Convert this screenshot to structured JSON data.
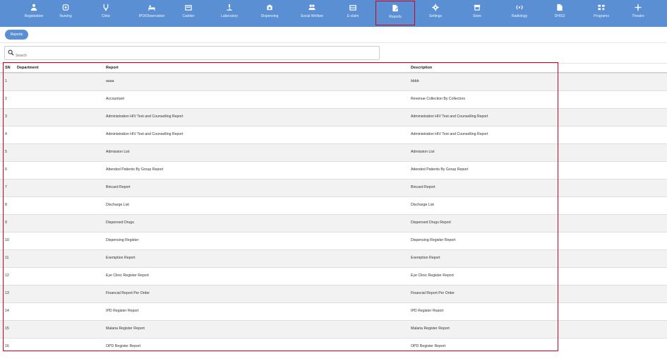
{
  "nav": {
    "items": [
      {
        "label": "Registration",
        "icon": "person-add-icon"
      },
      {
        "label": "Nursing",
        "icon": "nurse-icon"
      },
      {
        "label": "Clinic",
        "icon": "stethoscope-icon"
      },
      {
        "label": "IPD/Observation",
        "icon": "bed-icon"
      },
      {
        "label": "Cashier",
        "icon": "cash-register-icon"
      },
      {
        "label": "Laboratory",
        "icon": "microscope-icon"
      },
      {
        "label": "Dispensing",
        "icon": "medicine-box-icon"
      },
      {
        "label": "Social Welfare",
        "icon": "people-icon"
      },
      {
        "label": "E-claim",
        "icon": "claim-box-icon"
      },
      {
        "label": "Reports",
        "icon": "report-file-icon"
      },
      {
        "label": "Settings",
        "icon": "gear-icon"
      },
      {
        "label": "Store",
        "icon": "store-icon"
      },
      {
        "label": "Radiology",
        "icon": "radiology-icon"
      },
      {
        "label": "DHIS2",
        "icon": "upload-file-icon"
      },
      {
        "label": "Programs",
        "icon": "programs-icon"
      },
      {
        "label": "Theatre",
        "icon": "theatre-icon"
      }
    ],
    "active": "Reports",
    "colors": {
      "bar": "#5b8fd4",
      "highlight": "#d0021b"
    }
  },
  "breadcrumb": {
    "label": "Reports"
  },
  "search": {
    "placeholder": "Search",
    "value": ""
  },
  "table": {
    "headers": {
      "sn": "SN",
      "department": "Department",
      "report": "Report",
      "description": "Description"
    },
    "rows": [
      {
        "sn": "1",
        "department": "",
        "report": "aaaa",
        "description": "bbbb"
      },
      {
        "sn": "2",
        "department": "",
        "report": "Accountant",
        "description": "Revenue Collection By Collectors"
      },
      {
        "sn": "3",
        "department": "",
        "report": "Administration HIV Test and Counselling Report",
        "description": "Administration HIV Test and Counselling Report"
      },
      {
        "sn": "4",
        "department": "",
        "report": "Administration HIV Test and Counselling Report",
        "description": "Administration HIV Test and Counselling Report"
      },
      {
        "sn": "5",
        "department": "",
        "report": "Admission List",
        "description": "Admission List"
      },
      {
        "sn": "6",
        "department": "",
        "report": "Attended Patients By Group Report",
        "description": "Attended Patients By Group Report"
      },
      {
        "sn": "7",
        "department": "",
        "report": "Bincard Report",
        "description": "Bincard Report"
      },
      {
        "sn": "8",
        "department": "",
        "report": "Discharge List",
        "description": "Discharge List"
      },
      {
        "sn": "9",
        "department": "",
        "report": "Dispensed Drugs",
        "description": "Dispensed Drugs Report"
      },
      {
        "sn": "10",
        "department": "",
        "report": "Dispensing Register",
        "description": "Dispensing Register Report"
      },
      {
        "sn": "11",
        "department": "",
        "report": "Exemption Report",
        "description": "Exemption Report"
      },
      {
        "sn": "12",
        "department": "",
        "report": "Eye Clinic Register Report",
        "description": "Eye Clinic Register Report"
      },
      {
        "sn": "13",
        "department": "",
        "report": "Financial Report Per Order",
        "description": "Financial Report Per Order"
      },
      {
        "sn": "14",
        "department": "",
        "report": "IPD Register Report",
        "description": "IPD Register Report"
      },
      {
        "sn": "15",
        "department": "",
        "report": "Malaria Register Report",
        "description": "Malaria Register Report"
      },
      {
        "sn": "16",
        "department": "",
        "report": "OPD Register Report",
        "description": "OPD Register Report"
      }
    ]
  }
}
